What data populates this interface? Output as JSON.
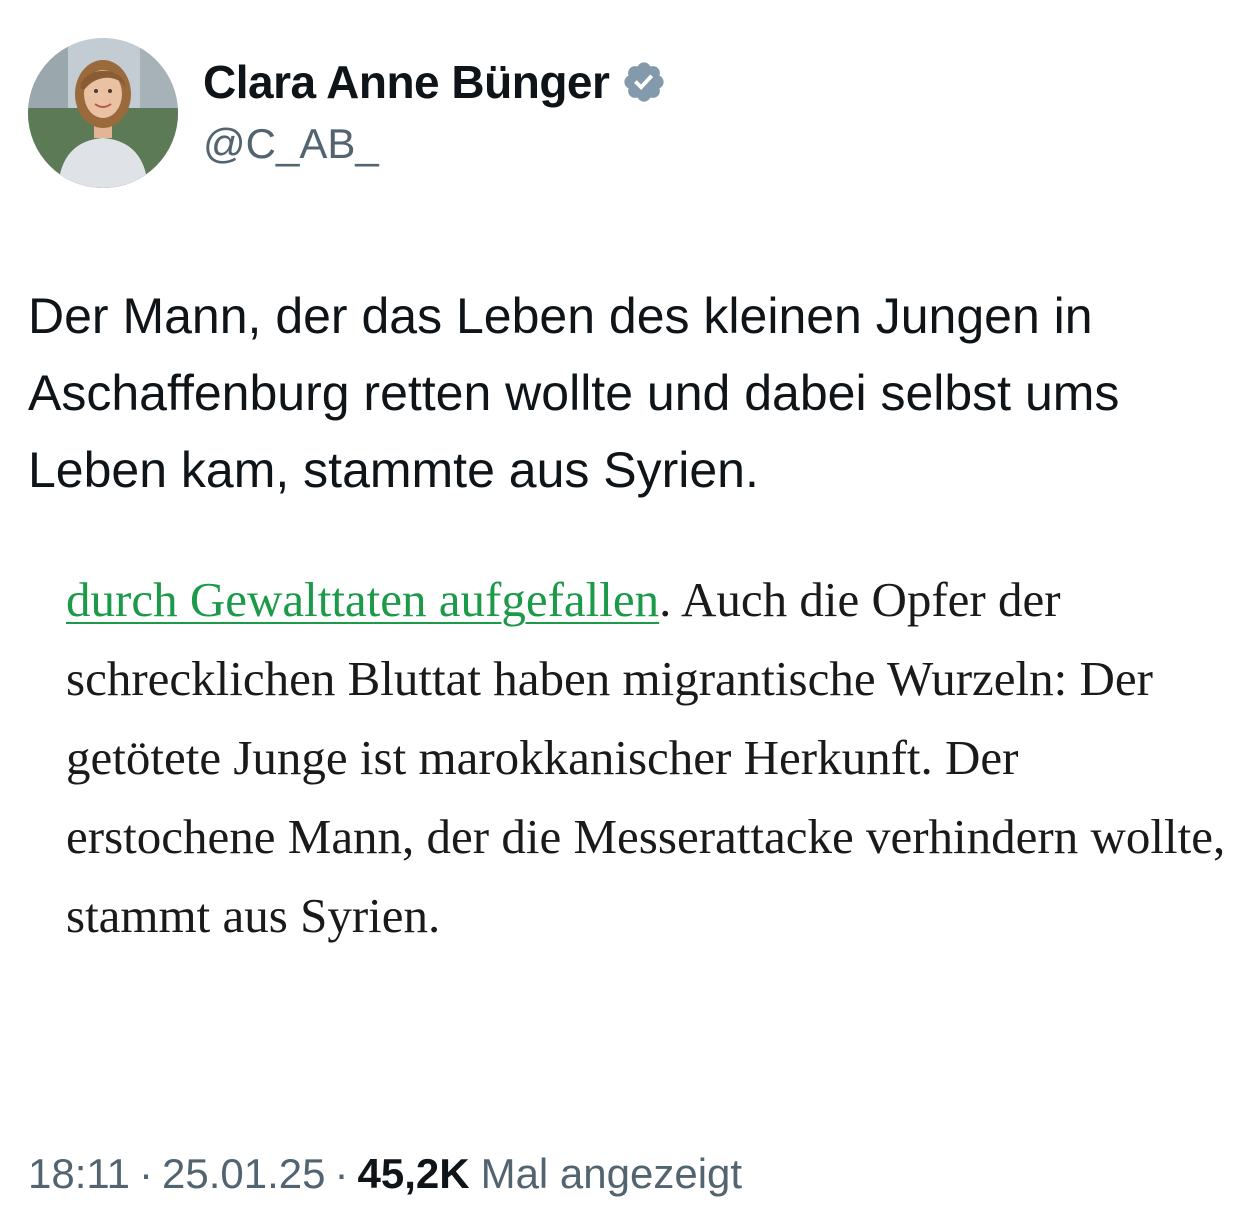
{
  "author": {
    "display_name": "Clara Anne Bünger",
    "handle": "@C_AB_",
    "verified_icon": "verified-badge-icon",
    "verified_color": "#829aab"
  },
  "tweet": {
    "text": "Der Mann, der das Leben des kleinen Jungen in Aschaffenburg retten wollte und dabei selbst ums Leben kam, stammte aus Syrien."
  },
  "article_image": {
    "link_text": "durch Gewalttaten aufgefallen",
    "link_color": "#1c9a4a",
    "body_text": ". Auch die Opfer der schrecklichen Bluttat haben migrantische Wurzeln: Der getötete Junge ist marokkanischer Herkunft. Der erstochene Mann, der die Messerattacke verhindern wollte, stammt aus Syrien."
  },
  "meta": {
    "time": "18:11",
    "separator": "·",
    "date": "25.01.25",
    "views_count": "45,2K",
    "views_label": "Mal angezeigt"
  }
}
